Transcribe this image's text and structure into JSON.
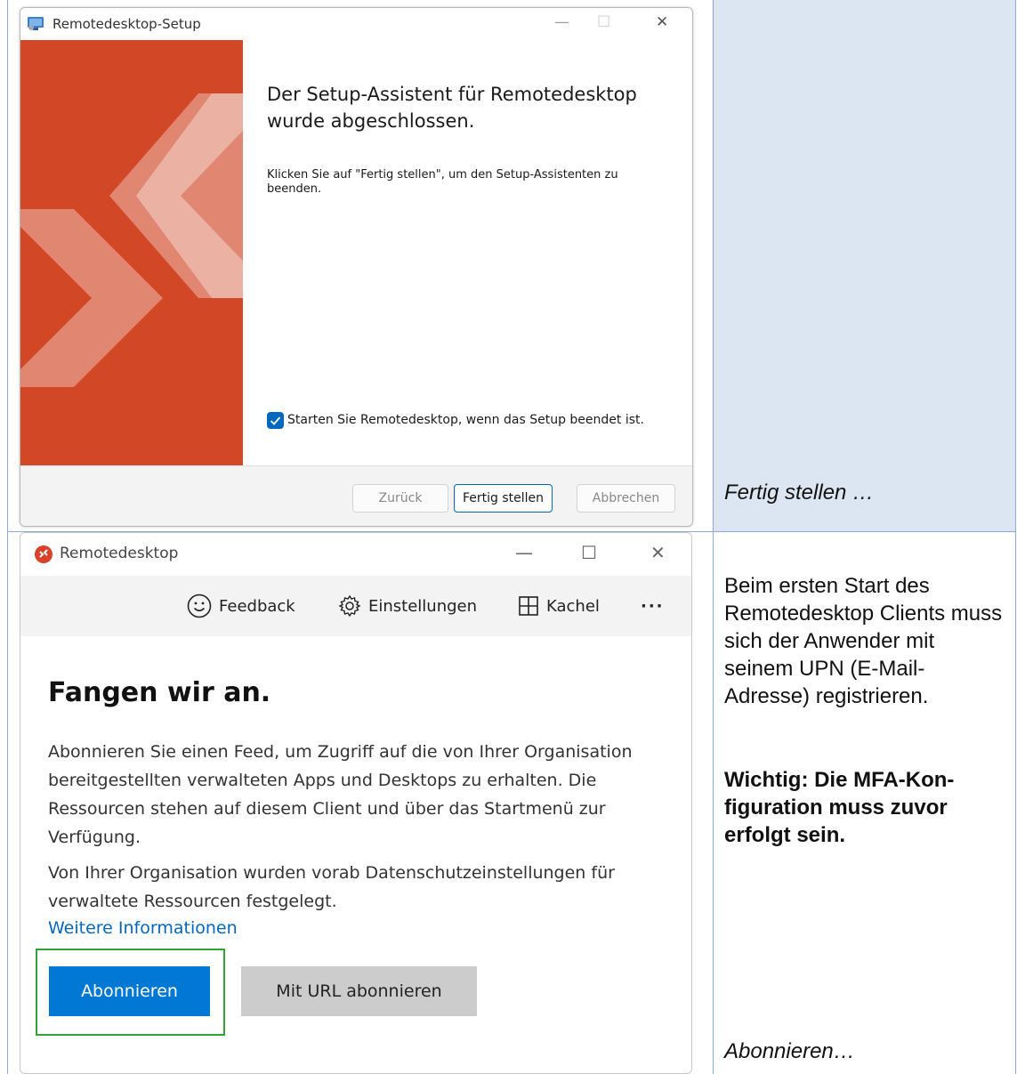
{
  "row1": {
    "setup_dialog": {
      "title": "Remotedesktop-Setup",
      "controls": {
        "minimize": "—",
        "maximize": "☐",
        "close": "✕"
      },
      "heading": "Der Setup-Assistent für Remotedesktop wurde abgeschlossen.",
      "body": "Klicken Sie auf \"Fertig stellen\", um den Setup-Assistenten zu beenden.",
      "checkbox_label": "Starten Sie Remotedesktop, wenn das Setup beendet ist.",
      "checkbox_checked": true,
      "buttons": {
        "back": "Zurück",
        "finish": "Fertig stellen",
        "cancel": "Abbrechen"
      },
      "colors": {
        "banner": "#d24726",
        "accent": "#0067c0"
      }
    },
    "caption": "Fertig stellen …"
  },
  "row2": {
    "rd_window": {
      "title": "Remotedesktop",
      "controls": {
        "minimize": "—",
        "maximize": "☐",
        "close": "✕"
      },
      "toolbar": {
        "feedback": "Feedback",
        "settings": "Einstellungen",
        "tile": "Kachel",
        "more": "···"
      },
      "toolbar_icons": [
        "smiley-icon",
        "gear-icon",
        "grid-icon",
        "more-icon"
      ],
      "heading": "Fangen wir an.",
      "paragraph1": "Abonnieren Sie einen Feed, um Zugriff auf die von Ihrer Organisation bereitgestellten verwalteten Apps und Desktops zu erhalten. Die Ressourcen stehen auf diesem Client und über das Startmenü zur Verfügung.",
      "paragraph2": "Von Ihrer Organisation wurden vorab Datenschutzeinstellungen für verwaltete Ressourcen festgelegt.",
      "more_info_link": "Weitere Informationen",
      "buttons": {
        "subscribe": "Abonnieren",
        "subscribe_url": "Mit URL abonnieren"
      },
      "colors": {
        "primary": "#0078d4",
        "highlight": "#32a338"
      }
    },
    "description": {
      "text": "Beim ersten Start des Remotedesktop Clients muss sich der Anwender mit seinem UPN (E-Mail-Adresse) registrieren.",
      "important": "Wichtig: Die MFA-Kon-figuration muss zuvor erfolgt sein."
    },
    "caption": "Abonnieren…"
  }
}
